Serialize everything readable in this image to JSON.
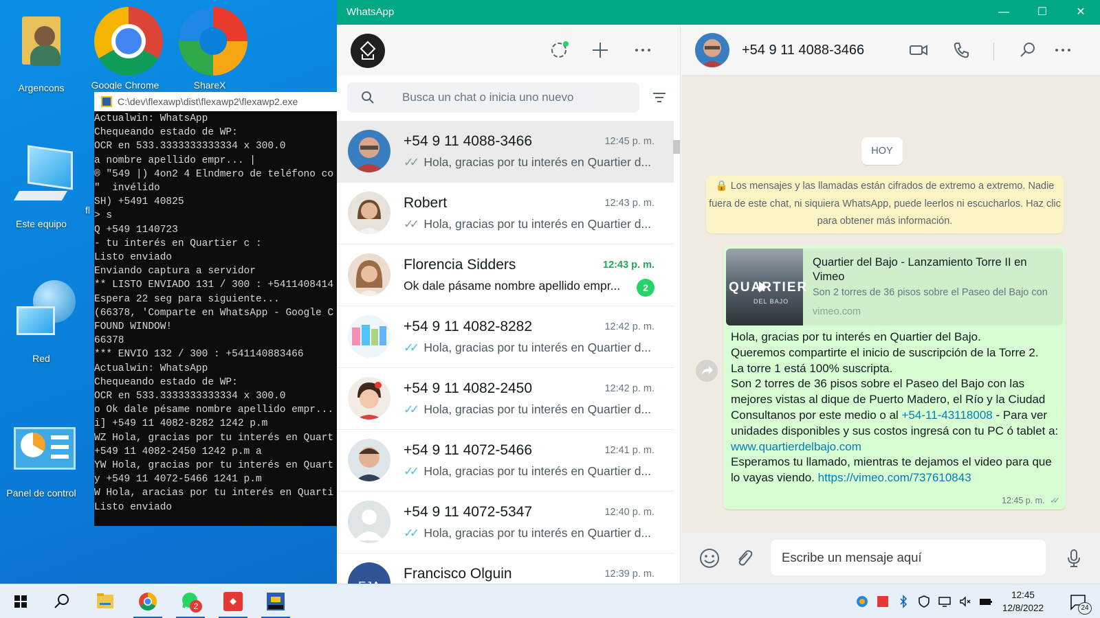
{
  "desktop": {
    "icons": [
      {
        "label": "Argencons"
      },
      {
        "label": "Google Chrome"
      },
      {
        "label": "ShareX"
      },
      {
        "label": "Este equipo"
      },
      {
        "label": "fl"
      },
      {
        "label": "Red"
      },
      {
        "label": "Panel de control"
      }
    ]
  },
  "console": {
    "title": "C:\\dev\\flexawp\\dist\\flexawp2\\flexawp2.exe",
    "lines": [
      "Actualwin: WhatsApp",
      "Chequeando estado de WP:",
      "OCR en 533.3333333333334 x 300.0",
      "a nombre apellido empr... |",
      "® \"549 |) 4on2 4 Elndmero de teléfono co",
      "\"  invélido",
      "SH) +5491 40825",
      "> s",
      "Q +549 1140723",
      "- tu interés en Quartier c :",
      "Listo enviado",
      "Enviando captura a servidor",
      "** LISTO ENVIADO 131 / 300 : +5411408414",
      "Espera 22 seg para siguiente...",
      "(66378, 'Comparte en WhatsApp - Google C",
      "FOUND WINDOW!",
      "66378",
      "*** ENVIO 132 / 300 : +541140883466",
      "Actualwin: WhatsApp",
      "Chequeando estado de WP:",
      "OCR en 533.3333333333334 x 300.0",
      "o Ok dale pésame nombre apellido empr...",
      "i] +549 11 4082-8282 1242 p.m",
      "WZ Hola, gracias por tu interés en Quart",
      "+549 11 4082-2450 1242 p.m a",
      "YW Hola, gracias por tu interés en Quart",
      "y +549 11 4072-5466 1241 p.m",
      "W Hola, aracias por tu interés en Quarti",
      "Listo enviado"
    ]
  },
  "whatsapp": {
    "window_title": "WhatsApp",
    "search_placeholder": "Busca un chat o inicia uno nuevo",
    "chats": [
      {
        "name": "+54 9 11 4088-3466",
        "time": "12:45 p. m.",
        "preview": "Hola, gracias por tu interés en Quartier d...",
        "tick": "gray",
        "unread": null,
        "active": true,
        "avatar": "photo-man-glasses"
      },
      {
        "name": "Robert",
        "time": "12:43 p. m.",
        "preview": "Hola, gracias por tu interés en Quartier d...",
        "tick": "gray",
        "unread": null,
        "active": false,
        "avatar": "photo-man-long-hair"
      },
      {
        "name": "Florencia Sidders",
        "time": "12:43 p. m.",
        "preview": "Ok dale pásame nombre apellido empr...",
        "tick": null,
        "unread": "2",
        "active": false,
        "avatar": "photo-woman"
      },
      {
        "name": "+54 9 11 4082-8282",
        "time": "12:42 p. m.",
        "preview": "Hola, gracias por tu interés en Quartier d...",
        "tick": "blue",
        "unread": null,
        "active": false,
        "avatar": "photo-colorful"
      },
      {
        "name": "+54 9 11 4082-2450",
        "time": "12:42 p. m.",
        "preview": "Hola, gracias por tu interés en Quartier d...",
        "tick": "blue",
        "unread": null,
        "active": false,
        "avatar": "photo-child"
      },
      {
        "name": "+54 9 11 4072-5466",
        "time": "12:41 p. m.",
        "preview": "Hola, gracias por tu interés en Quartier d...",
        "tick": "blue",
        "unread": null,
        "active": false,
        "avatar": "photo-man"
      },
      {
        "name": "+54 9 11 4072-5347",
        "time": "12:40 p. m.",
        "preview": "Hola, gracias por tu interés en Quartier d...",
        "tick": "blue",
        "unread": null,
        "active": false,
        "avatar": "default-avatar"
      },
      {
        "name": "Francisco Olguin",
        "time": "12:39 p. m.",
        "preview": "",
        "tick": null,
        "unread": null,
        "active": false,
        "avatar": "initials",
        "initials": "FJA"
      }
    ],
    "conversation": {
      "contact_name": "+54 9 11 4088-3466",
      "date_chip": "HOY",
      "encryption_notice": "Los mensajes y las llamadas están cifrados de extremo a extremo. Nadie fuera de este chat, ni siquiera WhatsApp, puede leerlos ni escucharlos. Haz clic para obtener más información.",
      "message": {
        "link_title": "Quartier del Bajo - Lanzamiento Torre II en Vimeo",
        "link_desc": "Son 2 torres de 36 pisos sobre el Paseo del Bajo con",
        "link_domain": "vimeo.com",
        "thumb_text": "QUARTIER",
        "thumb_sub": "DEL BAJO",
        "text_1": "Hola, gracias por tu interés en Quartier del Bajo.",
        "text_2": "Queremos compartirte el inicio de suscripción de la Torre 2.",
        "text_3": "La torre 1 está 100% suscripta.",
        "text_4": "Son 2 torres de 36 pisos sobre el Paseo del Bajo con las mejores vistas al dique de Puerto Madero, el Río y la Ciudad",
        "text_5a": "Consultanos por este medio o al ",
        "phone_link": "+54-11-43118008",
        "text_5b": " - Para ver unidades disponibles y sus costos ingresá con tu PC ó tablet a: ",
        "site_link": "www.quartierdelbajo.com",
        "text_6": "Esperamos tu llamado, mientras te dejamos el video para que lo vayas viendo. ",
        "video_link": "https://vimeo.com/737610843",
        "time": "12:45 p. m."
      },
      "composer_placeholder": "Escribe un mensaje aquí"
    }
  },
  "taskbar": {
    "clock_time": "12:45",
    "clock_date": "12/8/2022",
    "whatsapp_badge": "2",
    "notification_count": "24"
  },
  "colors": {
    "accent": "#00a884",
    "bubble_out": "#d9fdd3",
    "unread": "#25d366",
    "link": "#027eb5"
  }
}
